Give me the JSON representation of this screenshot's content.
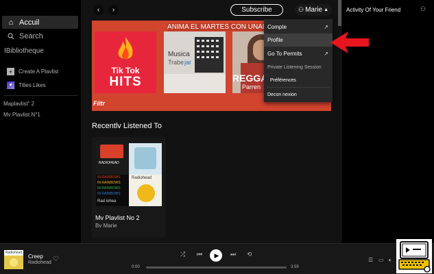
{
  "sidebar": {
    "home_label": "Accuil",
    "search_label": "Search",
    "library_label": "IBibliotheque",
    "create_playlist_label": "Create A Plavlist",
    "liked_label": "Titles Likes",
    "playlists": [
      "Maplavlist\" 2",
      "Mv Plavlist N°1"
    ]
  },
  "topbar": {
    "subscribe_label": "Subscribe",
    "user_name": "Marie",
    "back_icon": "chevron-left-icon",
    "forward_icon": "chevron-right-icon"
  },
  "banner": {
    "title": "ANIMA EL MARTES CON UNAPL",
    "brand_tag": "Filtr",
    "covers": [
      {
        "lines": [
          "Tik Tok",
          "HITS"
        ]
      },
      {
        "lines": [
          "Musica",
          "Trabe",
          "jar"
        ]
      },
      {
        "lines": [
          "REGGA",
          "Parren"
        ]
      }
    ]
  },
  "recent": {
    "section_title": "Recentlv Listened To",
    "card": {
      "name": "Mv Plavlist No 2",
      "sub": "Bv Marie",
      "art_texts": [
        "RADIOHEAD",
        "IN RAINBOWS",
        "IN RAINBOWS",
        "IN RAINBOWS",
        "IN RAINBOWS",
        "Radiohead",
        "Rad iohea",
        "Radiohead"
      ]
    }
  },
  "dropdown": {
    "items": [
      {
        "label": "Compte",
        "external": true
      },
      {
        "label": "Profile",
        "highlighted": true
      },
      {
        "label": "Go To Permits",
        "external": true
      },
      {
        "label": "Private Listening Session"
      },
      {
        "label": "Préférences"
      },
      {
        "label": "Decon nexion"
      }
    ]
  },
  "friends": {
    "title": "Activity Of Your Friend"
  },
  "player": {
    "track_title": "Creep",
    "artist": "Radiohead",
    "album_art_label": "Radiohead",
    "time_elapsed": "0:00",
    "time_total": "3:59",
    "progress": 0.0
  },
  "colors": {
    "accent_red": "#d1442e",
    "background": "#121212",
    "highlight": "#3e3e3e",
    "annotation_arrow": "#e8141e"
  }
}
